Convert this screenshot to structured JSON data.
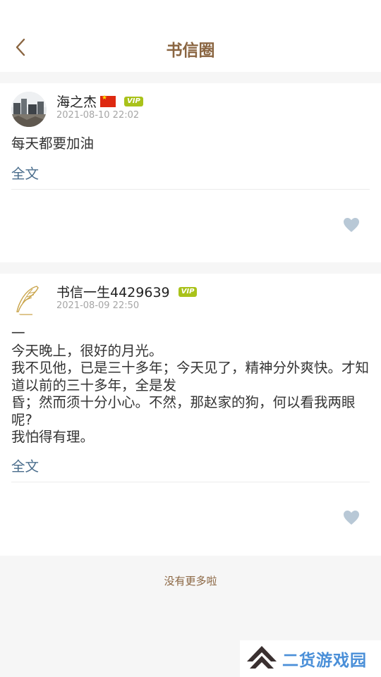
{
  "header": {
    "title": "书信圈"
  },
  "icons": {
    "back": "chevron-left-icon",
    "like": "heart-icon"
  },
  "colors": {
    "title": "#8a6541",
    "link": "#4a6d8c",
    "vip": "#a9c21a",
    "heart": "#b8c8d6"
  },
  "posts": [
    {
      "username": "海之杰",
      "badge": "VIP",
      "date": "2021-08-10 22:02",
      "content": "每天都要加油",
      "fulltext": "全文"
    },
    {
      "username": "书信一生4429639",
      "badge": "VIP",
      "date": "2021-08-09 22:50",
      "content": "一\n今天晚上，很好的月光。\n我不见他，已是三十多年；今天见了，精神分外爽快。才知道以前的三十多年，全是发\n昏；然而须十分小心。不然，那赵家的狗，何以看我两眼呢?\n我怕得有理。",
      "fulltext": "全文"
    }
  ],
  "footer": {
    "no_more": "没有更多啦"
  },
  "watermark": {
    "text": "二货游戏园"
  }
}
